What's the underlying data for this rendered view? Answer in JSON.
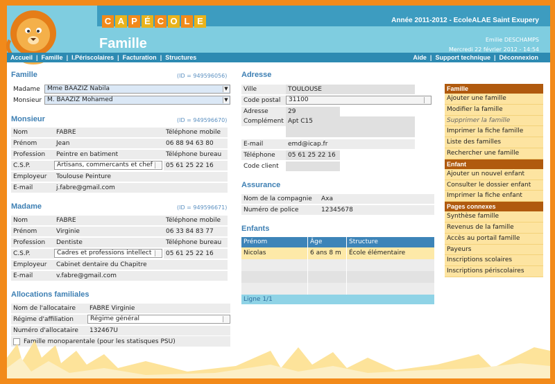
{
  "app": {
    "logo_letters": [
      "C",
      "A",
      "P",
      "É",
      "C",
      "O",
      "L",
      "E"
    ],
    "logo_colors": [
      "#f28a1a",
      "#e9b31c",
      "#f28a1a",
      "#e9b31c",
      "#f28a1a",
      "#e9b31c",
      "#f28a1a",
      "#e9b31c"
    ],
    "year": "Année 2011-2012 - EcoleALAE Saint Exupery",
    "page_title": "Famille",
    "user_name": "Emilie DESCHAMPS",
    "date": "Mercredi 22 février 2012 - 14:54"
  },
  "nav": {
    "left": [
      "Accueil",
      "Famille",
      "I.Périscolaires",
      "Facturation",
      "Structures"
    ],
    "right": [
      "Aide",
      "Support technique",
      "Déconnexion"
    ]
  },
  "famille": {
    "title": "Famille",
    "id": "(ID = 949596056)",
    "madame_label": "Madame",
    "madame_value": "Mme BAAZIZ Nabila",
    "monsieur_label": "Monsieur",
    "monsieur_value": "M. BAAZIZ Mohamed"
  },
  "monsieur": {
    "title": "Monsieur",
    "id": "(ID = 949596670)",
    "nom": "FABRE",
    "prenom": "Jean",
    "profession": "Peintre en batiment",
    "csp": "Artisans, commercants et chef",
    "employeur": "Toulouse Peinture",
    "email": "j.fabre@gmail.com",
    "tel_mobile_label": "Téléphone mobile",
    "tel_mobile": "06 88 94 63 80",
    "tel_bureau_label": "Téléphone bureau",
    "tel_bureau": "05 61 25 22 16"
  },
  "madame": {
    "title": "Madame",
    "id": "(ID = 949596671)",
    "nom": "FABRE",
    "prenom": "Virginie",
    "profession": "Dentiste",
    "csp": "Cadres et professions intellect",
    "employeur": "Cabinet dentaire du Chapitre",
    "email": "v.fabre@gmail.com",
    "tel_mobile_label": "Téléphone mobile",
    "tel_mobile": "06 33 84 83 77",
    "tel_bureau_label": "Téléphone bureau",
    "tel_bureau": "05 61 25 22 16"
  },
  "labels": {
    "nom": "Nom",
    "prenom": "Prénom",
    "profession": "Profession",
    "csp": "C.S.P.",
    "employeur": "Employeur",
    "email": "E-mail"
  },
  "allocations": {
    "title": "Allocations familiales",
    "nom_label": "Nom de l'allocataire",
    "nom": "FABRE Virginie",
    "regime_label": "Régime d'affiliation",
    "regime": "Régime général",
    "numero_label": "Numéro d'allocataire",
    "numero": "132467U",
    "mono_label": "Famille monoparentale (pour les statisques PSU)"
  },
  "adresse": {
    "title": "Adresse",
    "ville_label": "Ville",
    "ville": "TOULOUSE",
    "cp_label": "Code postal",
    "cp": "31100",
    "adresse_label": "Adresse",
    "adresse": "29",
    "complement_label": "Complément",
    "complement": "Apt C15",
    "email_label": "E-mail",
    "email": "emd@icap.fr",
    "telephone_label": "Téléphone",
    "telephone": "05 61 25 22 16",
    "code_client_label": "Code client",
    "code_client": ""
  },
  "assurance": {
    "title": "Assurance",
    "compagnie_label": "Nom de la compagnie",
    "compagnie": "Axa",
    "police_label": "Numéro de police",
    "police": "12345678"
  },
  "enfants": {
    "title": "Enfants",
    "headers": [
      "Prénom",
      "Âge",
      "Structure"
    ],
    "rows": [
      [
        "Nicolas",
        "6 ans 8 m",
        "École élémentaire"
      ],
      [
        "",
        "",
        ""
      ],
      [
        "",
        "",
        ""
      ],
      [
        "",
        "",
        ""
      ]
    ],
    "footer": "Ligne 1/1"
  },
  "sidebar": {
    "famille": {
      "header": "Famille",
      "items": [
        "Ajouter une famille",
        "Modifier la famille",
        "Supprimer la famille",
        "Imprimer la fiche famille",
        "Liste des familles",
        "Rechercher une famille"
      ]
    },
    "enfant": {
      "header": "Enfant",
      "items": [
        "Ajouter un nouvel enfant",
        "Consulter le dossier enfant",
        "Imprimer la fiche enfant"
      ]
    },
    "pages": {
      "header": "Pages connexes",
      "items": [
        "Synthèse famille",
        "Revenus de la famille",
        "Accès au portail famille",
        "Payeurs",
        "Inscriptions scolaires",
        "Inscriptions périscolaires"
      ]
    }
  }
}
